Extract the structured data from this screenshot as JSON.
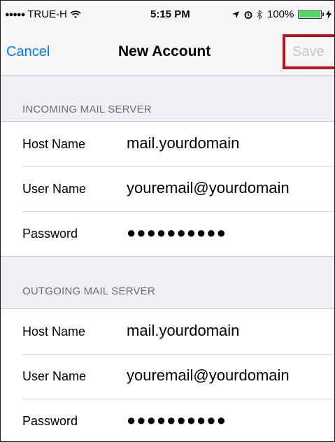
{
  "status_bar": {
    "carrier": "TRUE-H",
    "signal_dots": "●●●●●",
    "time": "5:15 PM",
    "battery": "100%",
    "battery_level": 1.0,
    "icons": [
      "wifi-icon",
      "location-icon",
      "alarm-icon",
      "bluetooth-icon",
      "battery-icon",
      "charging-icon"
    ]
  },
  "nav": {
    "cancel_label": "Cancel",
    "title": "New Account",
    "save_label": "Save"
  },
  "incoming": {
    "header": "INCOMING MAIL SERVER",
    "rows": [
      {
        "label": "Host Name",
        "value": "mail.yourdomain"
      },
      {
        "label": "User Name",
        "value": "youremail@yourdomain"
      },
      {
        "label": "Password",
        "value": "●●●●●●●●●●"
      }
    ]
  },
  "outgoing": {
    "header": "OUTGOING MAIL SERVER",
    "rows": [
      {
        "label": "Host Name",
        "value": "mail.yourdomain"
      },
      {
        "label": "User Name",
        "value": "youremail@yourdomain"
      },
      {
        "label": "Password",
        "value": "●●●●●●●●●●"
      }
    ]
  },
  "colors": {
    "accent": "#007aff",
    "highlight": "#c0121f",
    "disabled": "#c7c7cc",
    "background": "#efeff4"
  }
}
